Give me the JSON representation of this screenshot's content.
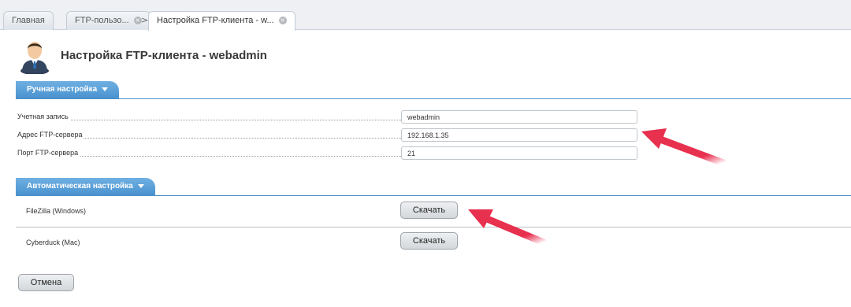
{
  "tabs": [
    {
      "label": "Главная"
    },
    {
      "label": "FTP-пользо..."
    },
    {
      "label": "Настройка FTP-клиента - w..."
    }
  ],
  "tab_separator": ">",
  "icons": {
    "close": "×",
    "user": "user-icon",
    "dropdown": "caret-down-icon"
  },
  "header": {
    "title": "Настройка FTP-клиента - webadmin"
  },
  "manual": {
    "title": "Ручная настройка",
    "fields": [
      {
        "label": "Учетная запись",
        "value": "webadmin"
      },
      {
        "label": "Адрес FTP-сервера",
        "value": "192.168.1.35"
      },
      {
        "label": "Порт FTP-сервера",
        "value": "21"
      }
    ]
  },
  "auto": {
    "title": "Автоматическая настройка",
    "clients": [
      {
        "label": "FileZilla (Windows)",
        "button": "Скачать"
      },
      {
        "label": "Cyberduck (Mac)",
        "button": "Скачать"
      }
    ]
  },
  "footer": {
    "cancel": "Отмена"
  },
  "colors": {
    "accent": "#4a92cf",
    "annotation_arrow": "#e8304f"
  }
}
